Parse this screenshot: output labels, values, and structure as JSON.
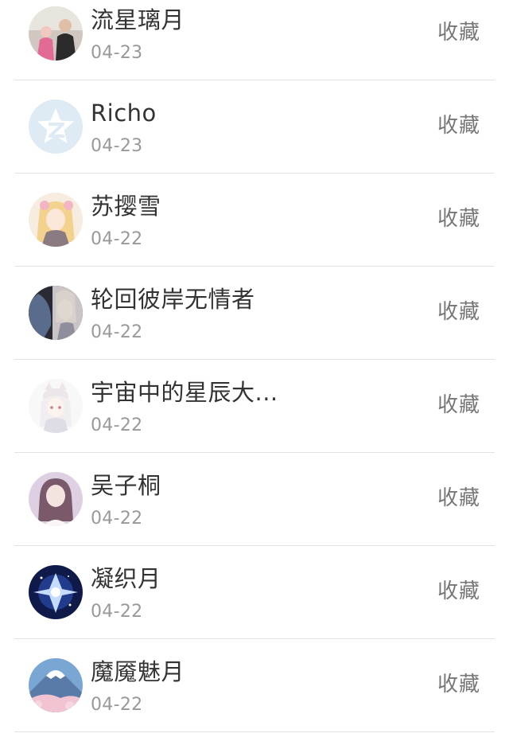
{
  "items": [
    {
      "name": "流星璃月",
      "date": "04-23",
      "action": "收藏",
      "avatar": "family-photo-avatar"
    },
    {
      "name": "Richo",
      "date": "04-23",
      "action": "收藏",
      "avatar": "qzone-default-avatar"
    },
    {
      "name": "苏撄雪",
      "date": "04-22",
      "action": "收藏",
      "avatar": "anime-girl-avatar"
    },
    {
      "name": "轮回彼岸无情者",
      "date": "04-22",
      "action": "收藏",
      "avatar": "dark-anime-avatar"
    },
    {
      "name": "宇宙中的星辰大...",
      "date": "04-22",
      "action": "收藏",
      "avatar": "white-cat-girl-avatar"
    },
    {
      "name": "吴子桐",
      "date": "04-22",
      "action": "收藏",
      "avatar": "portrait-girl-avatar"
    },
    {
      "name": "凝织月",
      "date": "04-22",
      "action": "收藏",
      "avatar": "blue-crystal-avatar"
    },
    {
      "name": "魔魇魅月",
      "date": "04-22",
      "action": "收藏",
      "avatar": "mount-fuji-avatar"
    }
  ]
}
